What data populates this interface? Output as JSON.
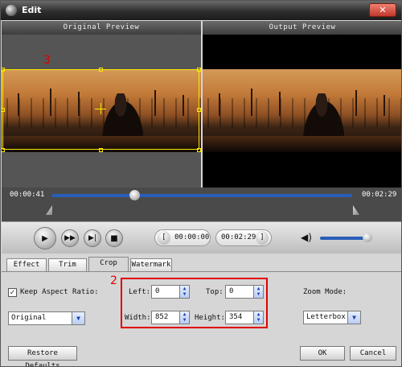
{
  "window": {
    "title": "Edit",
    "close_glyph": "✕"
  },
  "preview": {
    "original_label": "Original Preview",
    "output_label": "Output Preview"
  },
  "annotations": {
    "crop_marker": "3",
    "settings_marker": "2"
  },
  "timeline": {
    "current_time": "00:00:41",
    "total_time": "00:02:29",
    "progress_fraction": 0.28
  },
  "controls": {
    "play_icon": "play-icon",
    "fast_forward_icon": "fast-forward-icon",
    "step_icon": "step-frame-icon",
    "stop_icon": "stop-icon",
    "start_time": "00:00:00",
    "end_time": "00:02:29",
    "volume_fraction": 0.9
  },
  "tabs": [
    {
      "label": "Effect"
    },
    {
      "label": "Trim"
    },
    {
      "label": "Crop",
      "active": true
    },
    {
      "label": "Watermark"
    }
  ],
  "crop": {
    "keep_aspect_label": "Keep Aspect Ratio:",
    "keep_aspect_checked": true,
    "check_glyph": "✓",
    "aspect_value": "Original",
    "left_label": "Left:",
    "left_value": "0",
    "top_label": "Top:",
    "top_value": "0",
    "width_label": "Width:",
    "width_value": "852",
    "height_label": "Height:",
    "height_value": "354",
    "zoom_mode_label": "Zoom Mode:",
    "zoom_mode_value": "Letterbox"
  },
  "footer": {
    "restore_label": "Restore Defaults",
    "ok_label": "OK",
    "cancel_label": "Cancel"
  },
  "colors": {
    "accent_blue": "#2a5db8",
    "crop_yellow": "#ffe800",
    "annotation_red": "#e00000"
  }
}
